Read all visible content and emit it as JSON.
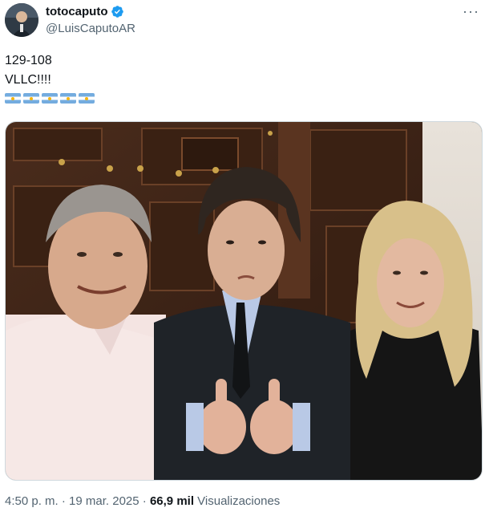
{
  "author": {
    "display_name": "totocaputo",
    "handle": "@LuisCaputoAR",
    "verified": true
  },
  "menu_icon": "more-horizontal-icon",
  "tweet": {
    "line1": "129-108",
    "line2": "VLLC!!!!",
    "flag_emoji": [
      "🇦🇷",
      "🇦🇷",
      "🇦🇷",
      "🇦🇷",
      "🇦🇷"
    ]
  },
  "photo": {
    "subjects": 3
  },
  "meta": {
    "time": "4:50 p. m.",
    "separator": " · ",
    "date": "19 mar. 2025",
    "views_count": "66,9 mil",
    "views_label": "Visualizaciones"
  },
  "colors": {
    "verified_blue": "#1d9bf0",
    "secondary_text": "#536471",
    "flag_blue": "#74acdf"
  }
}
